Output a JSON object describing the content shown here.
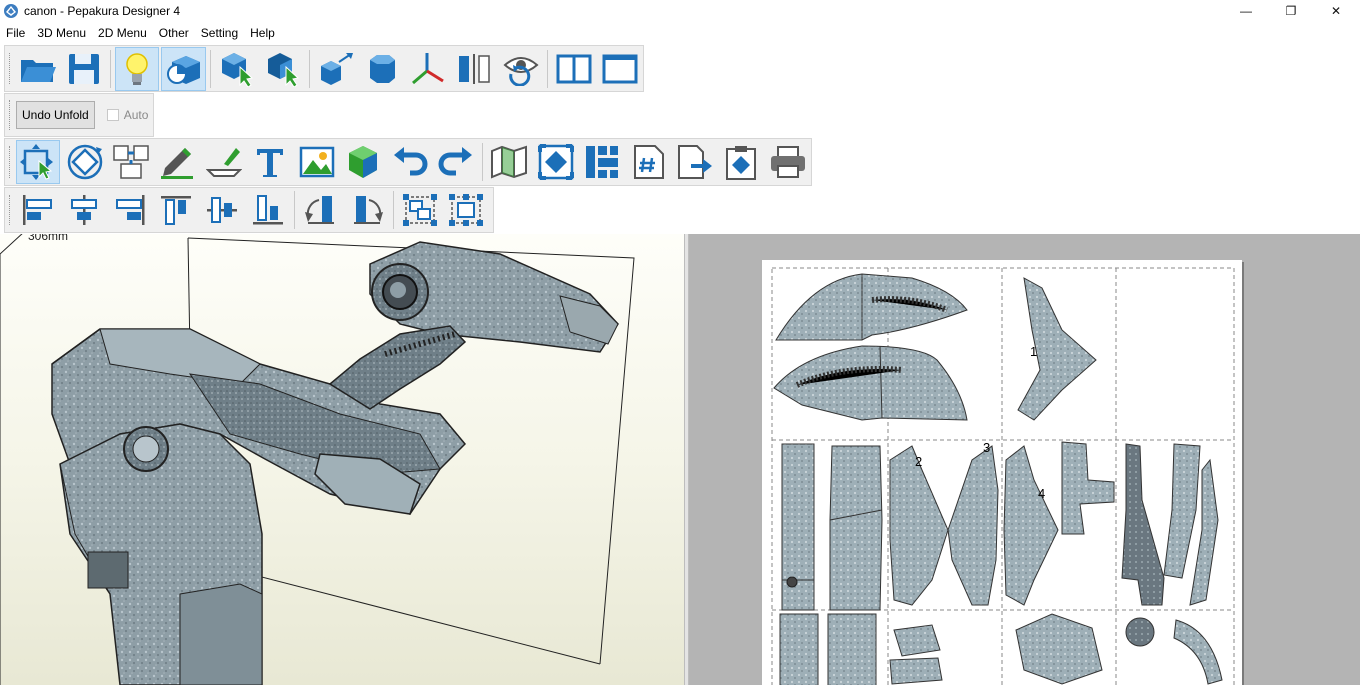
{
  "window": {
    "title": "canon - Pepakura Designer 4",
    "minimize_glyph": "—",
    "maximize_glyph": "❐",
    "close_glyph": "✕"
  },
  "menu": [
    "File",
    "3D Menu",
    "2D Menu",
    "Other",
    "Setting",
    "Help"
  ],
  "toolbar_row2": {
    "undo_unfold_label": "Undo Unfold",
    "auto_label": "Auto",
    "auto_checked": false
  },
  "view3d": {
    "scale_label": "306mm"
  },
  "view2d": {
    "part_numbers": [
      "1",
      "2",
      "3",
      "4"
    ]
  },
  "colors": {
    "accent_blue": "#1c6fb8",
    "active_button": "#cce4f7",
    "viewport_2d_bg": "#b4b4b4",
    "model_color": "#8e9ea6"
  }
}
